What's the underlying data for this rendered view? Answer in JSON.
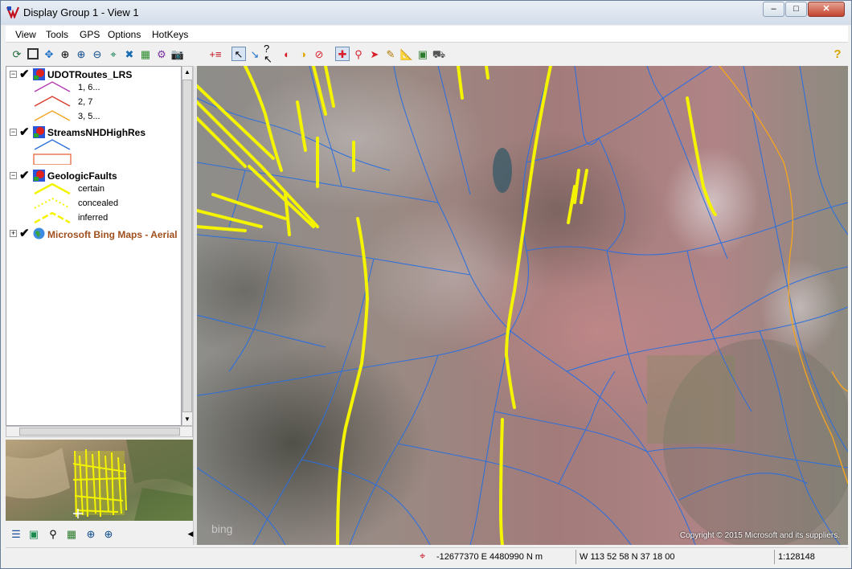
{
  "window": {
    "title": "Display Group 1 - View 1"
  },
  "window_controls": {
    "minimize": "–",
    "maximize": "□",
    "close": "✕"
  },
  "menu": {
    "items": [
      "View",
      "Tools",
      "GPS",
      "Options",
      "HotKeys"
    ]
  },
  "toolbar": {
    "icons": [
      "redraw-icon",
      "full-view-icon",
      "pan-icon",
      "zoom-box-icon",
      "zoom-in-icon",
      "zoom-out-icon",
      "zoom-to-icon",
      "zoom-layer-icon",
      "layers-icon",
      "scale-icon",
      "snapshot-icon",
      "add-layer-icon",
      "legend-select-icon",
      "identify-icon",
      "help-pointer-icon",
      "paint-icon",
      "paint-2-icon",
      "stop-icon",
      "move-icon",
      "find-icon",
      "select-icon",
      "sketch-icon",
      "ruler-icon",
      "profile-icon",
      "gps-icon",
      "help-icon"
    ],
    "help_label": "?"
  },
  "legend": {
    "layers": [
      {
        "name": "UDOTRoutes_LRS",
        "symbols": [
          {
            "label": "1, 6...",
            "color": "#b23bb0"
          },
          {
            "label": "2, 7",
            "color": "#d83a2a"
          },
          {
            "label": "3, 5...",
            "color": "#f2a321"
          }
        ]
      },
      {
        "name": "StreamsNHDHighRes",
        "symbols": [
          {
            "label": "",
            "color": "#2b6fdf"
          },
          {
            "label": "",
            "color": "#e8724a"
          }
        ]
      },
      {
        "name": "GeologicFaults",
        "symbols": [
          {
            "label": "certain",
            "color": "#f4f400"
          },
          {
            "label": "concealed",
            "color": "#f4f400"
          },
          {
            "label": "inferred",
            "color": "#f4f400"
          }
        ]
      },
      {
        "name": "Microsoft Bing Maps - Aerial",
        "color": "#a0501e"
      }
    ]
  },
  "overview_tools": [
    "layers-list-icon",
    "overview-layers-icon",
    "find-icon",
    "overview-extent-icon",
    "zoom-in-icon",
    "zoom-in-2-icon",
    "collapse-arrow-icon"
  ],
  "map": {
    "copyright": "Copyright © 2015 Microsoft and its suppliers.",
    "watermark": "bing",
    "stream_color": "#2b6fdf",
    "fault_color": "#f4f400",
    "route_color": "#f2a321"
  },
  "status": {
    "coords_projected": "-12677370 E  4480990 N  m",
    "coords_geographic": "W 113 52 58   N 37 18 00",
    "scale": "1:128148"
  }
}
